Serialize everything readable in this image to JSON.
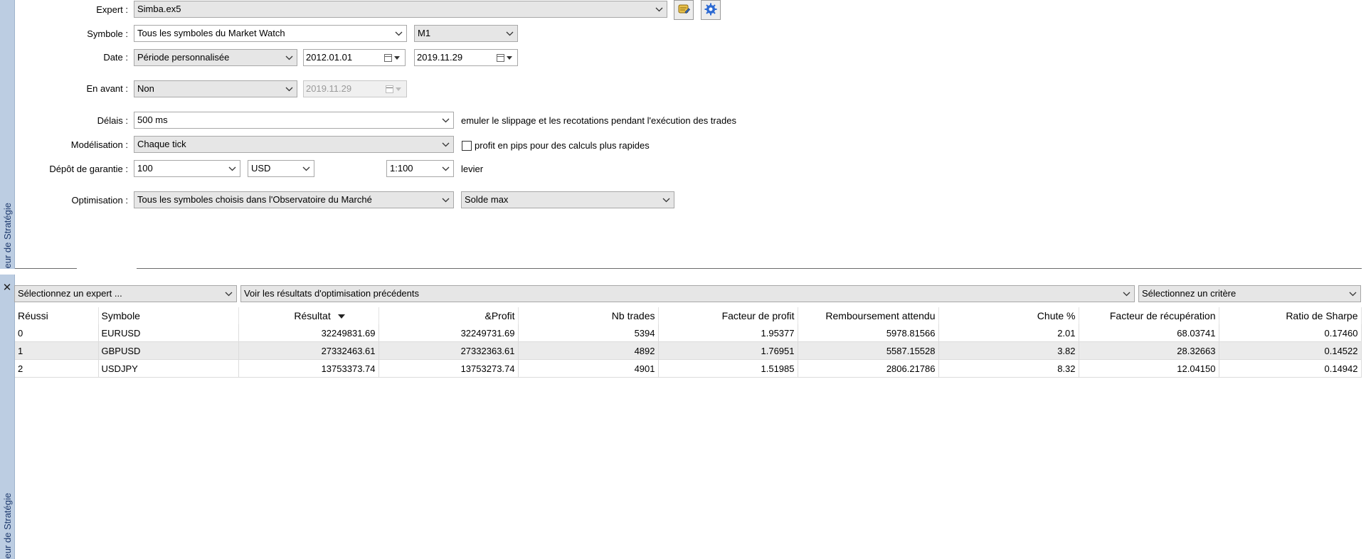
{
  "side_tab_label": "eur de Stratégie",
  "settings": {
    "expert": {
      "label": "Expert :",
      "value": "Simba.ex5"
    },
    "symbole": {
      "label": "Symbole :",
      "value": "Tous les symboles du Market Watch",
      "timeframe": "M1"
    },
    "date": {
      "label": "Date :",
      "value": "Période personnalisée",
      "from": "2012.01.01",
      "to": "2019.11.29"
    },
    "en_avant": {
      "label": "En avant :",
      "value": "Non",
      "date": "2019.11.29"
    },
    "delais": {
      "label": "Délais :",
      "value": "500 ms",
      "note": "emuler le slippage et les recotations pendant l'exécution des trades"
    },
    "modelisation": {
      "label": "Modélisation :",
      "value": "Chaque tick",
      "checkbox_label": "profit en pips pour des calculs plus rapides",
      "checked": false
    },
    "depot": {
      "label": "Dépôt de garantie :",
      "amount": "100",
      "currency": "USD",
      "leverage": "1:100",
      "leverage_label": "levier"
    },
    "optimisation": {
      "label": "Optimisation :",
      "value": "Tous les symboles choisis dans l'Observatoire du Marché",
      "criterion": "Solde max"
    }
  },
  "results": {
    "close_glyph": "✕",
    "filters": {
      "expert": "Sélectionnez un expert ...",
      "previous": "Voir les résultats d'optimisation précédents",
      "criterion": "Sélectionnez un critère"
    },
    "columns": [
      "Réussi",
      "Symbole",
      "Résultat",
      "&Profit",
      "Nb trades",
      "Facteur de profit",
      "Remboursement attendu",
      "Chute %",
      "Facteur de récupération",
      "Ratio de Sharpe"
    ],
    "sorted_column": "Résultat",
    "rows": [
      [
        "0",
        "EURUSD",
        "32249831.69",
        "32249731.69",
        "5394",
        "1.95377",
        "5978.81566",
        "2.01",
        "68.03741",
        "0.17460"
      ],
      [
        "1",
        "GBPUSD",
        "27332463.61",
        "27332363.61",
        "4892",
        "1.76951",
        "5587.15528",
        "3.82",
        "28.32663",
        "0.14522"
      ],
      [
        "2",
        "USDJPY",
        "13753373.74",
        "13753273.74",
        "4901",
        "1.51985",
        "2806.21786",
        "8.32",
        "12.04150",
        "0.14942"
      ]
    ]
  }
}
